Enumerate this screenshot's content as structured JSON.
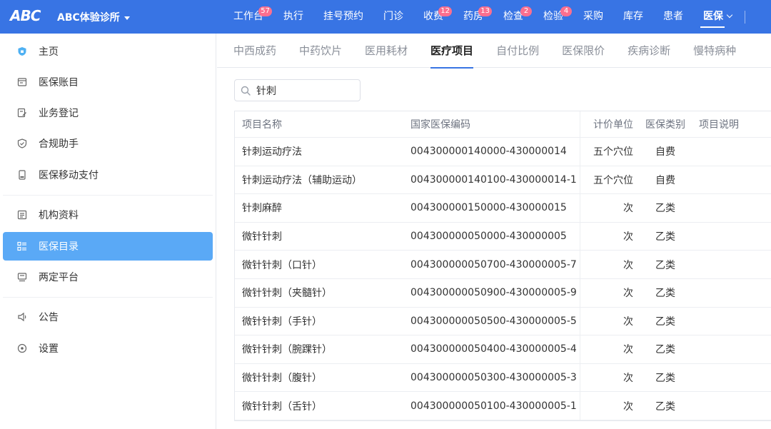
{
  "app": {
    "logo": "ABC",
    "clinic": "ABC体验诊所"
  },
  "nav": [
    {
      "label": "工作台",
      "badge": "57"
    },
    {
      "label": "执行",
      "badge": ""
    },
    {
      "label": "挂号预约",
      "badge": ""
    },
    {
      "label": "门诊",
      "badge": ""
    },
    {
      "label": "收费",
      "badge": "12"
    },
    {
      "label": "药房",
      "badge": "13"
    },
    {
      "label": "检查",
      "badge": "2"
    },
    {
      "label": "检验",
      "badge": "4"
    },
    {
      "label": "采购",
      "badge": ""
    },
    {
      "label": "库存",
      "badge": ""
    },
    {
      "label": "患者",
      "badge": ""
    },
    {
      "label": "医保",
      "badge": "",
      "active": true
    }
  ],
  "sidebar": {
    "items": [
      {
        "label": "主页",
        "icon": "home-shield-icon"
      },
      {
        "label": "医保账目",
        "icon": "ledger-icon"
      },
      {
        "label": "业务登记",
        "icon": "register-icon"
      },
      {
        "label": "合规助手",
        "icon": "compliance-shield-icon"
      },
      {
        "label": "医保移动支付",
        "icon": "mobile-pay-icon"
      },
      {
        "label": "机构资料",
        "icon": "document-icon"
      },
      {
        "label": "医保目录",
        "icon": "catalog-icon",
        "active": true
      },
      {
        "label": "两定平台",
        "icon": "platform-icon"
      },
      {
        "label": "公告",
        "icon": "speaker-icon"
      },
      {
        "label": "设置",
        "icon": "settings-icon"
      }
    ]
  },
  "tabs": [
    "中西成药",
    "中药饮片",
    "医用耗材",
    "医疗项目",
    "自付比例",
    "医保限价",
    "疾病诊断",
    "慢特病种"
  ],
  "active_tab": "医疗项目",
  "search": {
    "value": "针刺",
    "placeholder": ""
  },
  "table": {
    "headers": {
      "name": "项目名称",
      "code": "国家医保编码",
      "unit": "计价单位",
      "type": "医保类别",
      "desc": "项目说明"
    },
    "rows": [
      {
        "name": "针刺运动疗法",
        "code": "004300000140000-430000014",
        "unit": "五个穴位",
        "type": "自费",
        "desc": ""
      },
      {
        "name": "针刺运动疗法（辅助运动）",
        "code": "004300000140100-430000014-1",
        "unit": "五个穴位",
        "type": "自费",
        "desc": ""
      },
      {
        "name": "针刺麻醉",
        "code": "004300000150000-430000015",
        "unit": "次",
        "type": "乙类",
        "desc": ""
      },
      {
        "name": "微针针刺",
        "code": "004300000050000-430000005",
        "unit": "次",
        "type": "乙类",
        "desc": ""
      },
      {
        "name": "微针针刺（口针）",
        "code": "004300000050700-430000005-7",
        "unit": "次",
        "type": "乙类",
        "desc": ""
      },
      {
        "name": "微针针刺（夹髓针）",
        "code": "004300000050900-430000005-9",
        "unit": "次",
        "type": "乙类",
        "desc": ""
      },
      {
        "name": "微针针刺（手针）",
        "code": "004300000050500-430000005-5",
        "unit": "次",
        "type": "乙类",
        "desc": ""
      },
      {
        "name": "微针针刺（腕踝针）",
        "code": "004300000050400-430000005-4",
        "unit": "次",
        "type": "乙类",
        "desc": ""
      },
      {
        "name": "微针针刺（腹针）",
        "code": "004300000050300-430000005-3",
        "unit": "次",
        "type": "乙类",
        "desc": ""
      },
      {
        "name": "微针针刺（舌针）",
        "code": "004300000050100-430000005-1",
        "unit": "次",
        "type": "乙类",
        "desc": ""
      }
    ]
  },
  "colors": {
    "topbar": "#3874e4",
    "active_side": "#5aa9f6",
    "badge": "#fb6f8f",
    "accent": "#3874e4"
  }
}
